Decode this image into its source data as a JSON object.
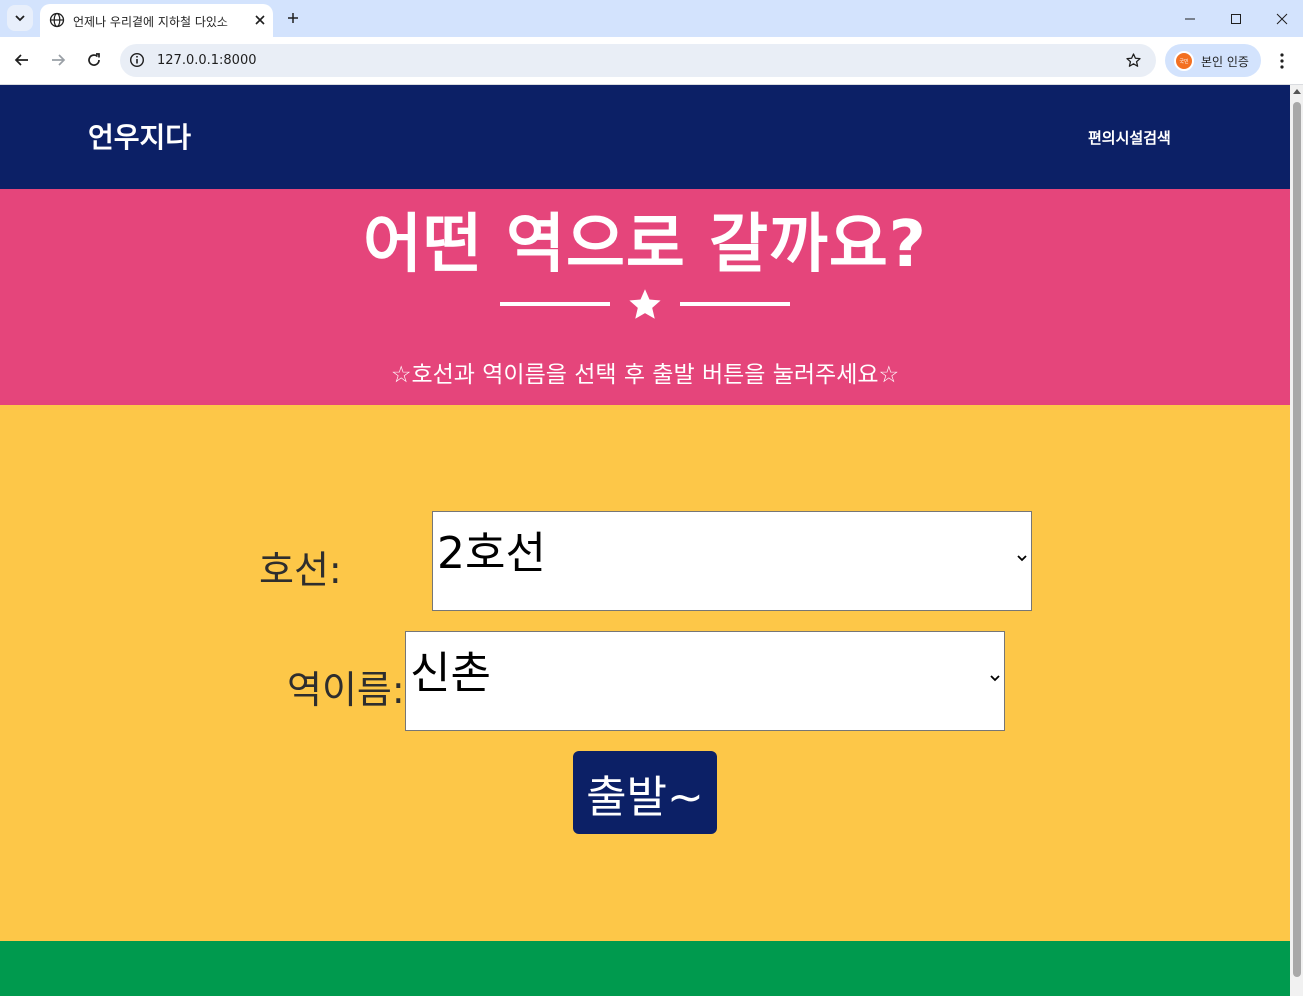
{
  "browser": {
    "tab_title": "언제나 우리곁에 지하철 다있소",
    "url": "127.0.0.1:8000",
    "profile_label": "본인 인증",
    "profile_badge": "국민"
  },
  "nav": {
    "brand": "언우지다",
    "link": "편의시설검색"
  },
  "hero": {
    "title": "어떤 역으로 갈까요?",
    "subtitle": "☆호선과 역이름을 선택 후 출발 버튼을 눌러주세요☆"
  },
  "form": {
    "line_label": "호선:",
    "line_value": "2호선",
    "station_label": "역이름:",
    "station_value": "신촌",
    "submit_label": "출발~"
  },
  "colors": {
    "navbar": "#0c2066",
    "hero": "#e5457b",
    "form_bg": "#fdc748",
    "footer": "#009a4e",
    "button": "#0c2066"
  },
  "icons": [
    "tab-search-icon",
    "globe-icon",
    "close-icon",
    "plus-icon",
    "minimize-icon",
    "maximize-icon",
    "window-close-icon",
    "back-icon",
    "forward-icon",
    "reload-icon",
    "info-icon",
    "star-icon",
    "menu-icon",
    "chevron-down-icon"
  ]
}
